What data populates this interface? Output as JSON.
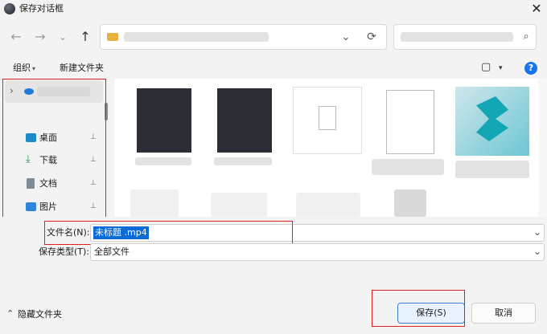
{
  "window": {
    "title": "保存对话框",
    "close_glyph": "✕"
  },
  "nav": {
    "back": "←",
    "forward": "→",
    "dropdown": "⌄",
    "up": "↑",
    "refresh": "⟳",
    "address_dropdown": "⌄",
    "search_glyph": "⌕"
  },
  "toolbar": {
    "organize": "组织",
    "new_folder": "新建文件夹",
    "view_glyph": "▢",
    "view_dropdown": "▾",
    "help": "?"
  },
  "sidebar": {
    "top_chevron": "›",
    "items": [
      {
        "label": "桌面",
        "icon": "desktop-icon"
      },
      {
        "label": "下载",
        "icon": "download-icon"
      },
      {
        "label": "文档",
        "icon": "document-icon"
      },
      {
        "label": "图片",
        "icon": "picture-icon"
      }
    ],
    "pin_glyph": "📌"
  },
  "form": {
    "filename_label": "文件名(N):",
    "filename_value": "未标题 .mp4",
    "filetype_label": "保存类型(T):",
    "filetype_value": "全部文件",
    "dropdown_glyph": "⌄"
  },
  "bottom": {
    "hide_folders": "隐藏文件夹",
    "hide_chevron": "⌃",
    "save": "保存(S)",
    "cancel": "取消"
  },
  "colors": {
    "highlight_red": "#e02020",
    "selection_blue": "#0a6ad6"
  }
}
